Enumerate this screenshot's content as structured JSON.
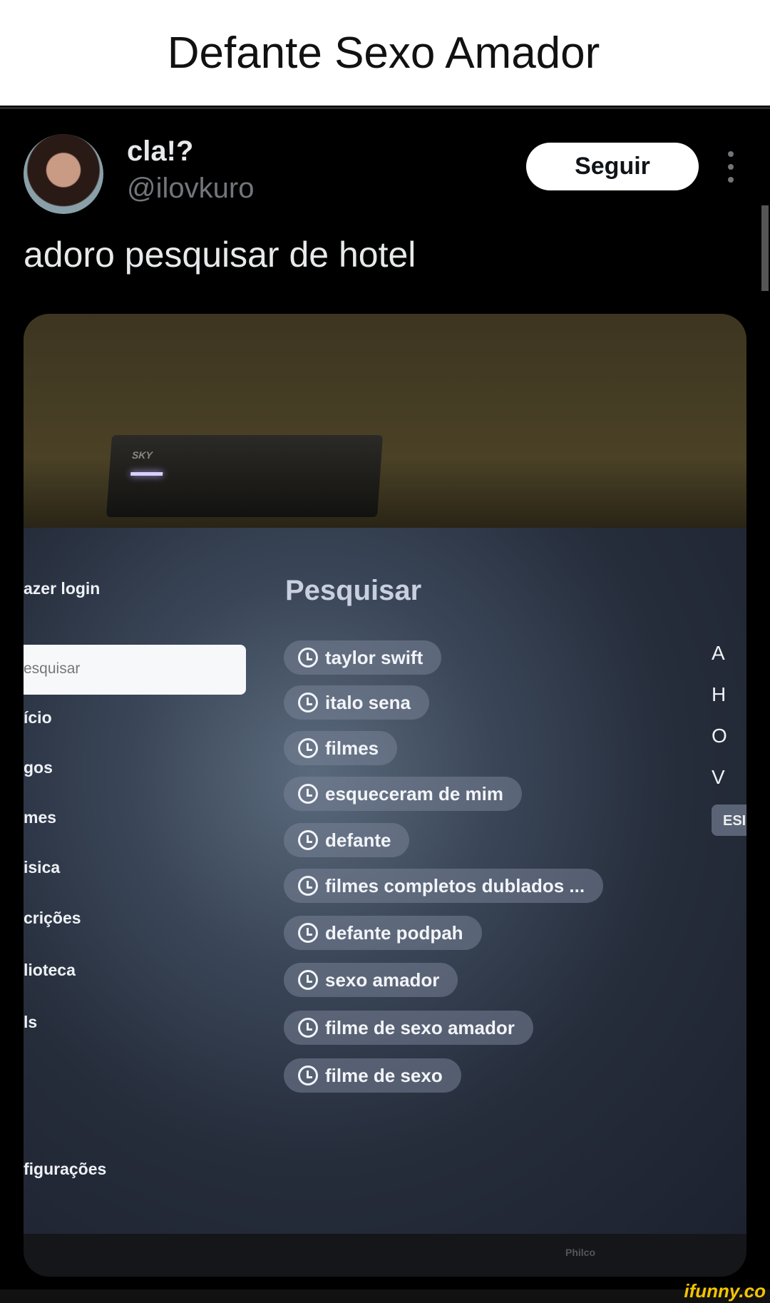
{
  "page_title": "Defante Sexo Amador",
  "tweet": {
    "name": "cla!?",
    "handle": "@ilovkuro",
    "follow_label": "Seguir",
    "text": "adoro pesquisar de hotel"
  },
  "photo": {
    "box_brand": "SKY",
    "tv_brand": "Philco",
    "sidebar": [
      "azer login",
      "ício",
      "gos",
      "mes",
      "isica",
      "crições",
      "lioteca",
      "ls",
      "figurações"
    ],
    "search_placeholder": "esquisar",
    "search_title": "Pesquisar",
    "history": [
      "taylor swift",
      "italo sena",
      "filmes",
      "esqueceram de mim",
      "defante",
      "filmes completos dublados ...",
      "defante podpah",
      "sexo amador",
      "filme de sexo amador",
      "filme de sexo"
    ],
    "keyboard_letters": [
      "A",
      "H",
      "O",
      "V"
    ],
    "keyboard_key": "ESI"
  },
  "watermark": "ifunny.co"
}
